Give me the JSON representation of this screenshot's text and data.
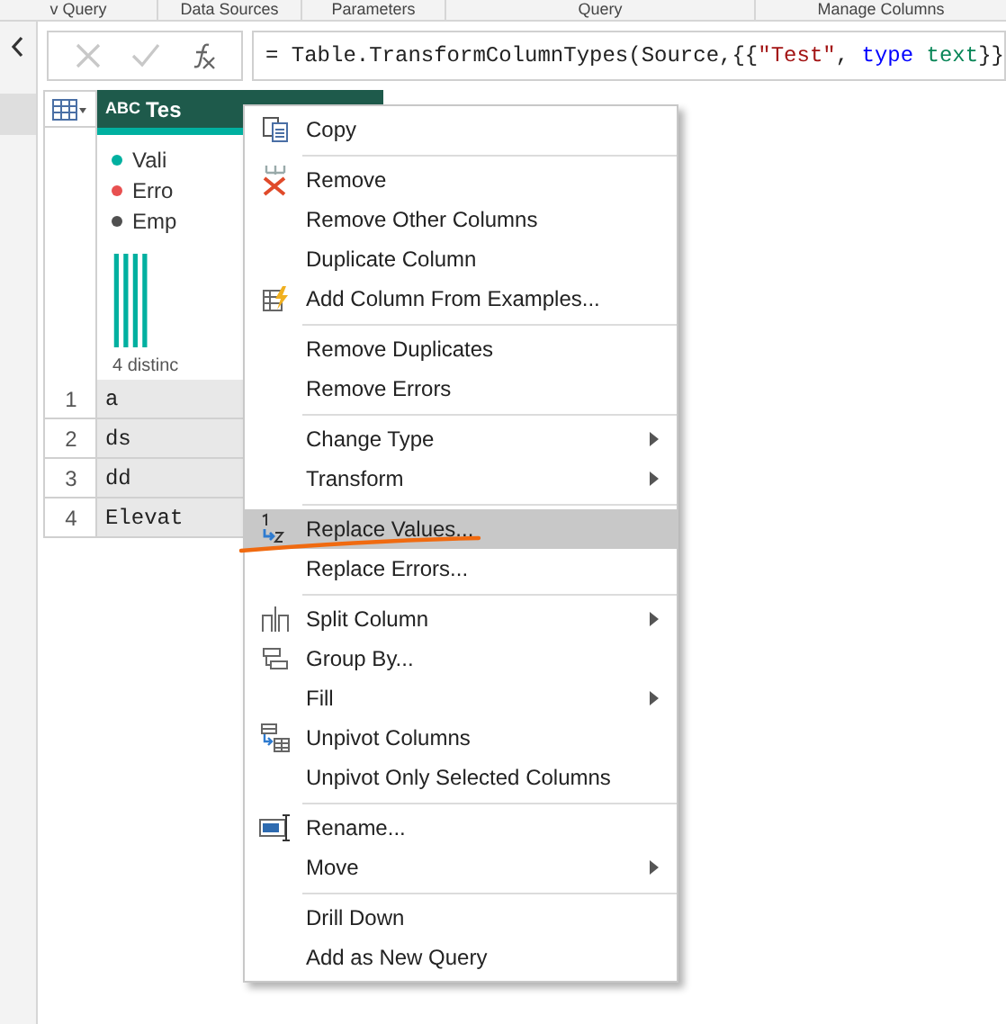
{
  "ribbon_groups": [
    "v Query",
    "Data Sources",
    "Parameters",
    "Query",
    "Manage Columns"
  ],
  "formula_bar": {
    "segments": [
      {
        "kind": "plain",
        "text": "= Table.TransformColumnTypes(Source,{{"
      },
      {
        "kind": "string",
        "text": "\"Test\""
      },
      {
        "kind": "plain",
        "text": ", "
      },
      {
        "kind": "keyword",
        "text": "type"
      },
      {
        "kind": "typename",
        "text": " text"
      },
      {
        "kind": "plain",
        "text": "}}"
      }
    ]
  },
  "queries_pane": {
    "items": [
      {
        "selected": true
      }
    ]
  },
  "table": {
    "column": {
      "type_label": "ABC",
      "name": "Tes",
      "selected": true
    },
    "profile": {
      "legend": [
        {
          "label": "Vali",
          "color": "#00b0a0"
        },
        {
          "label": "Erro",
          "color": "#e85050"
        },
        {
          "label": "Emp",
          "color": "#505050"
        }
      ],
      "distinct": "4 distinc"
    },
    "rows": [
      {
        "number": "1",
        "value": "a"
      },
      {
        "number": "2",
        "value": "ds"
      },
      {
        "number": "3",
        "value": "dd"
      },
      {
        "number": "4",
        "value": "Elevat"
      }
    ]
  },
  "context_menu": {
    "groups": [
      {
        "items": [
          {
            "kind": "copy",
            "label": "Copy",
            "submenu": false,
            "selected": false
          }
        ]
      },
      {
        "items": [
          {
            "kind": "remove",
            "label": "Remove",
            "submenu": false,
            "selected": false
          },
          {
            "kind": "plain",
            "label": "Remove Other Columns",
            "submenu": false,
            "selected": false
          },
          {
            "kind": "plain",
            "label": "Duplicate Column",
            "submenu": false,
            "selected": false
          },
          {
            "kind": "examples",
            "label": "Add Column From Examples...",
            "submenu": false,
            "selected": false
          }
        ]
      },
      {
        "items": [
          {
            "kind": "plain",
            "label": "Remove Duplicates",
            "submenu": false,
            "selected": false
          },
          {
            "kind": "plain",
            "label": "Remove Errors",
            "submenu": false,
            "selected": false
          }
        ]
      },
      {
        "items": [
          {
            "kind": "plain",
            "label": "Change Type",
            "submenu": true,
            "selected": false
          },
          {
            "kind": "plain",
            "label": "Transform",
            "submenu": true,
            "selected": false
          }
        ]
      },
      {
        "items": [
          {
            "kind": "replace",
            "label": "Replace Values...",
            "submenu": false,
            "selected": true
          },
          {
            "kind": "plain",
            "label": "Replace Errors...",
            "submenu": false,
            "selected": false
          }
        ]
      },
      {
        "items": [
          {
            "kind": "split",
            "label": "Split Column",
            "submenu": true,
            "selected": false
          },
          {
            "kind": "group",
            "label": "Group By...",
            "submenu": false,
            "selected": false
          },
          {
            "kind": "plain",
            "label": "Fill",
            "submenu": true,
            "selected": false
          },
          {
            "kind": "unpivot",
            "label": "Unpivot Columns",
            "submenu": false,
            "selected": false
          },
          {
            "kind": "plain",
            "label": "Unpivot Only Selected Columns",
            "submenu": false,
            "selected": false
          }
        ]
      },
      {
        "items": [
          {
            "kind": "rename",
            "label": "Rename...",
            "submenu": false,
            "selected": false
          },
          {
            "kind": "plain",
            "label": "Move",
            "submenu": true,
            "selected": false
          }
        ]
      },
      {
        "items": [
          {
            "kind": "plain",
            "label": "Drill Down",
            "submenu": false,
            "selected": false
          },
          {
            "kind": "plain",
            "label": "Add as New Query",
            "submenu": false,
            "selected": false
          }
        ]
      }
    ]
  }
}
